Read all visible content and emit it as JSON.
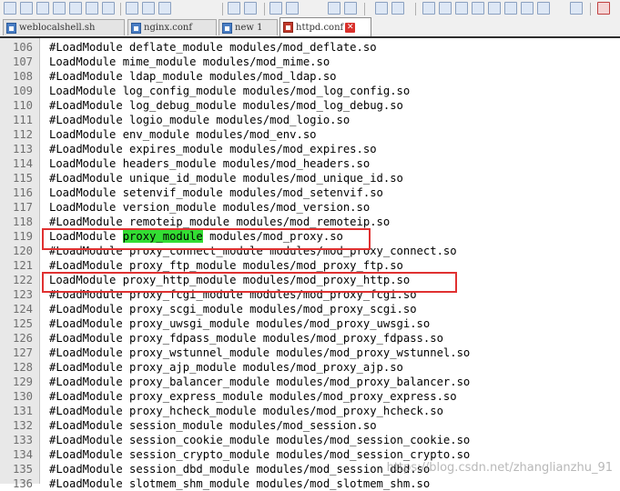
{
  "tabs": [
    {
      "label": "weblocalshell.sh",
      "active": false
    },
    {
      "label": "nginx.conf",
      "active": false
    },
    {
      "label": "new 1",
      "active": false
    },
    {
      "label": "httpd.conf",
      "active": true
    }
  ],
  "tab_close_glyph": "✕",
  "editor": {
    "lines": [
      {
        "num": "106",
        "text": "#LoadModule deflate_module modules/mod_deflate.so"
      },
      {
        "num": "107",
        "text": "LoadModule mime_module modules/mod_mime.so"
      },
      {
        "num": "108",
        "text": "#LoadModule ldap_module modules/mod_ldap.so"
      },
      {
        "num": "109",
        "text": "LoadModule log_config_module modules/mod_log_config.so"
      },
      {
        "num": "110",
        "text": "#LoadModule log_debug_module modules/mod_log_debug.so"
      },
      {
        "num": "111",
        "text": "#LoadModule logio_module modules/mod_logio.so"
      },
      {
        "num": "112",
        "text": "LoadModule env_module modules/mod_env.so"
      },
      {
        "num": "113",
        "text": "#LoadModule expires_module modules/mod_expires.so"
      },
      {
        "num": "114",
        "text": "LoadModule headers_module modules/mod_headers.so"
      },
      {
        "num": "115",
        "text": "#LoadModule unique_id_module modules/mod_unique_id.so"
      },
      {
        "num": "116",
        "text": "LoadModule setenvif_module modules/mod_setenvif.so"
      },
      {
        "num": "117",
        "text": "LoadModule version_module modules/mod_version.so"
      },
      {
        "num": "118",
        "text": "#LoadModule remoteip_module modules/mod_remoteip.so"
      },
      {
        "num": "119",
        "pre": "LoadModule ",
        "hl": "proxy_module",
        "post": " modules/mod_proxy.so"
      },
      {
        "num": "120",
        "text": "#LoadModule proxy_connect_module modules/mod_proxy_connect.so"
      },
      {
        "num": "121",
        "text": "#LoadModule proxy_ftp_module modules/mod_proxy_ftp.so"
      },
      {
        "num": "122",
        "text": "LoadModule proxy_http_module modules/mod_proxy_http.so"
      },
      {
        "num": "123",
        "text": "#LoadModule proxy_fcgi_module modules/mod_proxy_fcgi.so"
      },
      {
        "num": "124",
        "text": "#LoadModule proxy_scgi_module modules/mod_proxy_scgi.so"
      },
      {
        "num": "125",
        "text": "#LoadModule proxy_uwsgi_module modules/mod_proxy_uwsgi.so"
      },
      {
        "num": "126",
        "text": "#LoadModule proxy_fdpass_module modules/mod_proxy_fdpass.so"
      },
      {
        "num": "127",
        "text": "#LoadModule proxy_wstunnel_module modules/mod_proxy_wstunnel.so"
      },
      {
        "num": "128",
        "text": "#LoadModule proxy_ajp_module modules/mod_proxy_ajp.so"
      },
      {
        "num": "129",
        "text": "#LoadModule proxy_balancer_module modules/mod_proxy_balancer.so"
      },
      {
        "num": "130",
        "text": "#LoadModule proxy_express_module modules/mod_proxy_express.so"
      },
      {
        "num": "131",
        "text": "#LoadModule proxy_hcheck_module modules/mod_proxy_hcheck.so"
      },
      {
        "num": "132",
        "text": "#LoadModule session_module modules/mod_session.so"
      },
      {
        "num": "133",
        "text": "#LoadModule session_cookie_module modules/mod_session_cookie.so"
      },
      {
        "num": "134",
        "text": "#LoadModule session_crypto_module modules/mod_session_crypto.so"
      },
      {
        "num": "135",
        "text": "#LoadModule session_dbd_module modules/mod_session_dbd.so"
      },
      {
        "num": "136",
        "text": "#LoadModule slotmem_shm_module modules/mod_slotmem_shm.so"
      }
    ]
  },
  "watermark": "https://blog.csdn.net/zhanglianzhu_91",
  "colors": {
    "highlight": "#33dd33",
    "annotation_box": "#e03131"
  }
}
